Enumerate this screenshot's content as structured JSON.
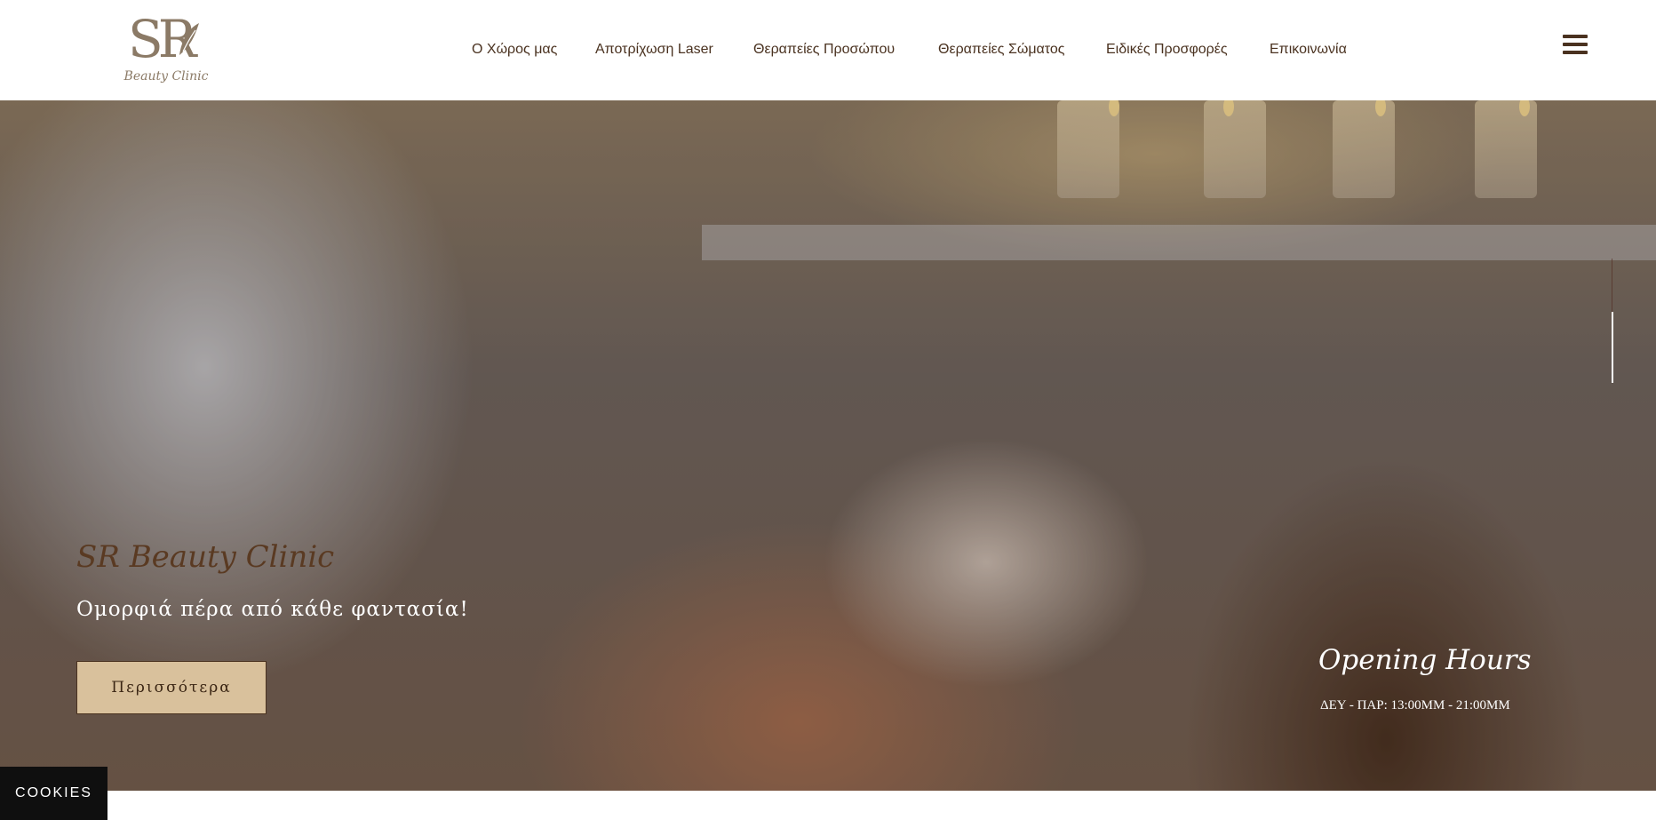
{
  "brand": {
    "logo_mark": "SR",
    "logo_script": "Beauty Clinic"
  },
  "nav": {
    "items": [
      {
        "label": "Ο Χώρος μας"
      },
      {
        "label": "Αποτρίχωση Laser"
      },
      {
        "label": "Θεραπείες Προσώπου"
      },
      {
        "label": "Θεραπείες Σώματος"
      },
      {
        "label": "Ειδικές Προσφορές"
      },
      {
        "label": "Επικοινωνία"
      }
    ],
    "menu_icon": "hamburger-menu-icon"
  },
  "hero": {
    "title": "SR Beauty Clinic",
    "subtitle": "Ομορφιά πέρα από κάθε φαντασία!",
    "button_label": "Περισσότερα",
    "opening_hours_title": "Opening Hours",
    "opening_hours_text": "ΔΕΥ - ΠΑΡ: 13:00ΜΜ - 21:00ΜΜ"
  },
  "cookies": {
    "label": "COOKIES"
  },
  "colors": {
    "brand_brown": "#4a3220",
    "button_beige": "#d9c19c",
    "logo_taupe": "#8b7a66"
  }
}
